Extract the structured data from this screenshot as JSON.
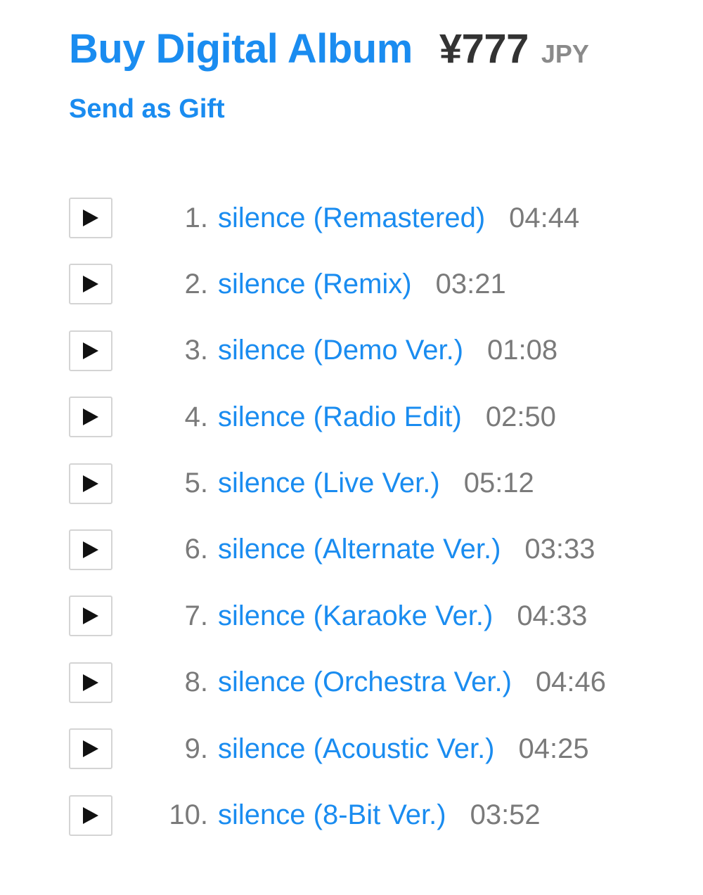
{
  "purchase": {
    "buy_label": "Buy Digital Album",
    "price": "¥777",
    "currency": "JPY",
    "gift_label": "Send as Gift"
  },
  "tracks": [
    {
      "num": "1.",
      "title": "silence (Remastered)",
      "duration": "04:44"
    },
    {
      "num": "2.",
      "title": "silence (Remix)",
      "duration": "03:21"
    },
    {
      "num": "3.",
      "title": "silence (Demo Ver.)",
      "duration": "01:08"
    },
    {
      "num": "4.",
      "title": "silence (Radio Edit)",
      "duration": "02:50"
    },
    {
      "num": "5.",
      "title": "silence (Live Ver.)",
      "duration": "05:12"
    },
    {
      "num": "6.",
      "title": "silence (Alternate Ver.)",
      "duration": "03:33"
    },
    {
      "num": "7.",
      "title": "silence (Karaoke Ver.)",
      "duration": "04:33"
    },
    {
      "num": "8.",
      "title": "silence (Orchestra Ver.)",
      "duration": "04:46"
    },
    {
      "num": "9.",
      "title": "silence (Acoustic Ver.)",
      "duration": "04:25"
    },
    {
      "num": "10.",
      "title": "silence (8-Bit Ver.)",
      "duration": "03:52"
    }
  ],
  "icons": {
    "play": "play-icon"
  },
  "colors": {
    "link": "#1a8cf0",
    "price": "#333333",
    "muted": "#7a7a7a",
    "button_border": "#d4d4d4"
  }
}
